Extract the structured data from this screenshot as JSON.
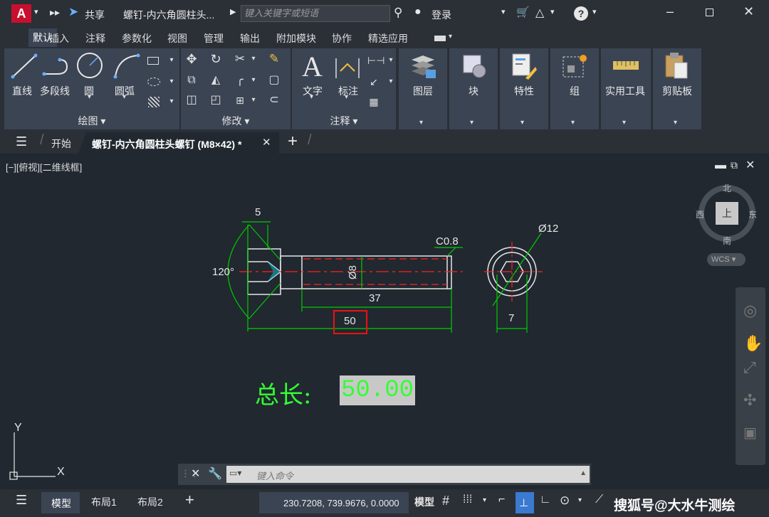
{
  "titlebar": {
    "share": "共享",
    "doc_title": "螺钉-内六角圆柱头...",
    "search_placeholder": "键入关键字或短语",
    "login": "登录",
    "app_logo": "A"
  },
  "ribbon_tabs": [
    "默认",
    "插入",
    "注释",
    "参数化",
    "视图",
    "管理",
    "输出",
    "附加模块",
    "协作",
    "精选应用"
  ],
  "panels": {
    "draw": {
      "title": "绘图",
      "line": "直线",
      "polyline": "多段线",
      "circle": "圆",
      "arc": "圆弧"
    },
    "modify": {
      "title": "修改"
    },
    "annotation": {
      "title": "注释",
      "text": "文字",
      "dimension": "标注"
    },
    "layers": "图层",
    "block": "块",
    "properties": "特性",
    "groups": "组",
    "utilities": "实用工具",
    "clipboard": "剪贴板"
  },
  "doc_tabs": {
    "start": "开始",
    "active": "螺钉-内六角圆柱头螺钉 (M8×42) *"
  },
  "viewport": {
    "label": "[−][俯视][二维线框]",
    "compass": {
      "north": "北",
      "south": "南",
      "east": "东",
      "west": "西",
      "top": "上",
      "wcs": "WCS"
    },
    "dims": {
      "d5": "5",
      "angle": "120°",
      "c08": "C0.8",
      "d8": "Ø8",
      "d37": "37",
      "d50": "50",
      "d12": "Ø12",
      "d7": "7"
    },
    "total_label": "总长:",
    "total_value": "50.00",
    "axis_y": "Y",
    "axis_x": "X"
  },
  "command": {
    "placeholder": "键入命令"
  },
  "status": {
    "model_tab": "模型",
    "layout1": "布局1",
    "layout2": "布局2",
    "coords": "230.7208, 739.9676, 0.0000",
    "model_btn": "模型",
    "watermark": "搜狐号@大水牛测绘"
  },
  "colors": {
    "accent_red": "#c8102e",
    "dim_green": "#00cc00",
    "bright_green": "#33ff33",
    "center_red": "#ff2020"
  }
}
